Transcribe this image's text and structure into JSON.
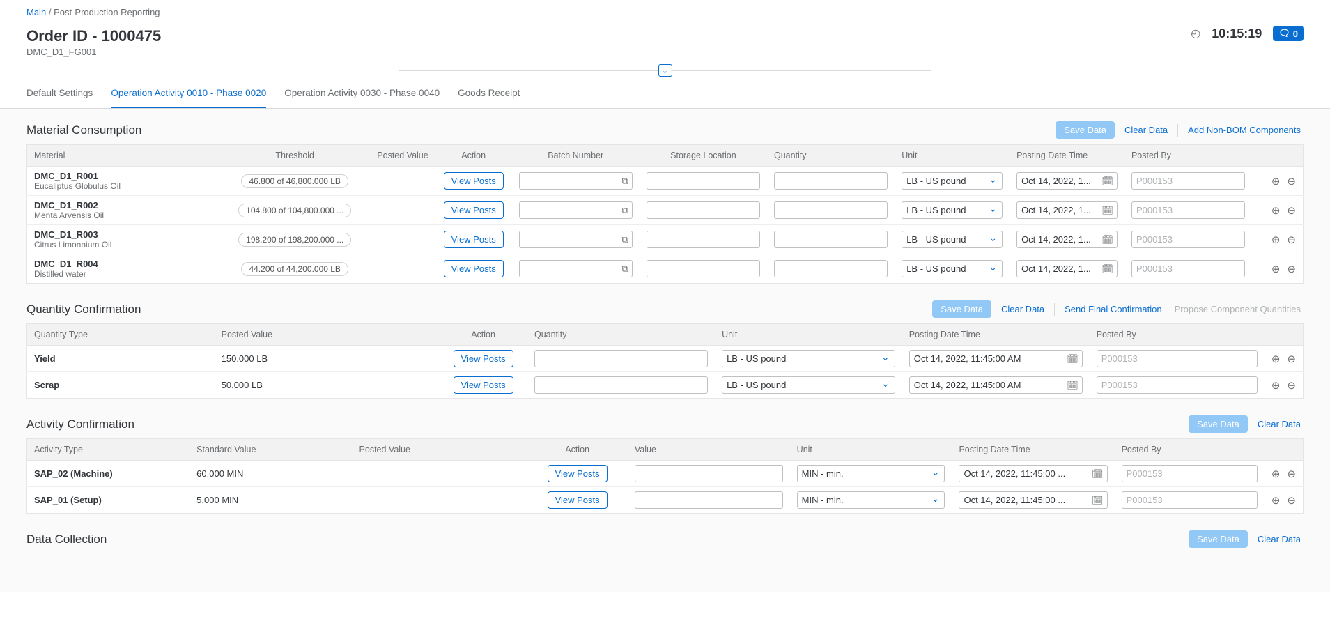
{
  "breadcrumb": {
    "main": "Main",
    "sep": "/",
    "page": "Post-Production Reporting"
  },
  "header": {
    "order_title": "Order ID - 1000475",
    "order_sub": "DMC_D1_FG001",
    "time": "10:15:19",
    "msg_count": "0"
  },
  "tabs": [
    {
      "label": "Default Settings"
    },
    {
      "label": "Operation Activity 0010 - Phase 0020"
    },
    {
      "label": "Operation Activity 0030 - Phase 0040"
    },
    {
      "label": "Goods Receipt"
    }
  ],
  "material_consumption": {
    "title": "Material Consumption",
    "save": "Save Data",
    "clear": "Clear Data",
    "add": "Add Non-BOM Components",
    "cols": {
      "material": "Material",
      "threshold": "Threshold",
      "posted_value": "Posted Value",
      "action": "Action",
      "batch": "Batch Number",
      "storage": "Storage Location",
      "quantity": "Quantity",
      "unit": "Unit",
      "pdt": "Posting Date Time",
      "posted_by": "Posted By"
    },
    "view_posts": "View Posts",
    "unit_option": "LB - US pound",
    "pdt_value": "Oct 14, 2022, 1...",
    "posted_by_ph": "P000153",
    "rows": [
      {
        "code": "DMC_D1_R001",
        "desc": "Eucaliptus Globulus Oil",
        "threshold": "46.800 of 46,800.000 LB"
      },
      {
        "code": "DMC_D1_R002",
        "desc": "Menta Arvensis Oil",
        "threshold": "104.800 of 104,800.000 ..."
      },
      {
        "code": "DMC_D1_R003",
        "desc": "Citrus Limonnium Oil",
        "threshold": "198.200 of 198,200.000 ..."
      },
      {
        "code": "DMC_D1_R004",
        "desc": "Distilled water",
        "threshold": "44.200 of 44,200.000 LB"
      }
    ]
  },
  "quantity_confirmation": {
    "title": "Quantity Confirmation",
    "save": "Save Data",
    "clear": "Clear Data",
    "send_final": "Send Final Confirmation",
    "propose": "Propose Component Quantities",
    "cols": {
      "qtype": "Quantity Type",
      "posted_value": "Posted Value",
      "action": "Action",
      "quantity": "Quantity",
      "unit": "Unit",
      "pdt": "Posting Date Time",
      "posted_by": "Posted By"
    },
    "view_posts": "View Posts",
    "unit_option": "LB - US pound",
    "pdt_value": "Oct 14, 2022, 11:45:00 AM",
    "posted_by_ph": "P000153",
    "rows": [
      {
        "qtype": "Yield",
        "posted_value": "150.000 LB"
      },
      {
        "qtype": "Scrap",
        "posted_value": "50.000 LB"
      }
    ]
  },
  "activity_confirmation": {
    "title": "Activity Confirmation",
    "save": "Save Data",
    "clear": "Clear Data",
    "cols": {
      "atype": "Activity Type",
      "standard": "Standard Value",
      "posted_value": "Posted Value",
      "action": "Action",
      "value": "Value",
      "unit": "Unit",
      "pdt": "Posting Date Time",
      "posted_by": "Posted By"
    },
    "view_posts": "View Posts",
    "unit_option": "MIN - min.",
    "pdt_value": "Oct 14, 2022, 11:45:00 ...",
    "posted_by_ph": "P000153",
    "rows": [
      {
        "atype": "SAP_02 (Machine)",
        "standard": "60.000 MIN"
      },
      {
        "atype": "SAP_01 (Setup)",
        "standard": "5.000 MIN"
      }
    ]
  },
  "data_collection": {
    "title": "Data Collection",
    "save": "Save Data",
    "clear": "Clear Data"
  }
}
